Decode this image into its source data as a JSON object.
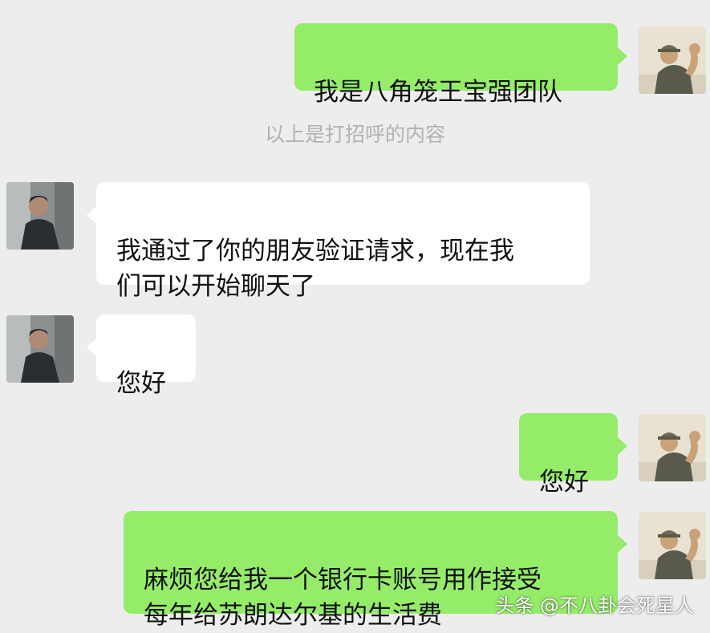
{
  "system_note": "以上是打招呼的内容",
  "messages": [
    {
      "sender": "self",
      "text": "我是八角笼王宝强团队"
    },
    {
      "sender": "other",
      "text": "我通过了你的朋友验证请求，现在我\n们可以开始聊天了"
    },
    {
      "sender": "other",
      "text": "您好"
    },
    {
      "sender": "self",
      "text": "您好"
    },
    {
      "sender": "self",
      "text": "麻烦您给我一个银行卡账号用作接受\n每年给苏朗达尔基的生活费"
    }
  ],
  "watermark": "头条 @不八卦会死星人",
  "colors": {
    "background": "#ededed",
    "self_bubble": "#95ec69",
    "other_bubble": "#ffffff",
    "system_text": "#b2b2b2"
  },
  "avatars": {
    "self": "avatar-person-cap-flexing",
    "other": "avatar-man-dark-jacket"
  }
}
